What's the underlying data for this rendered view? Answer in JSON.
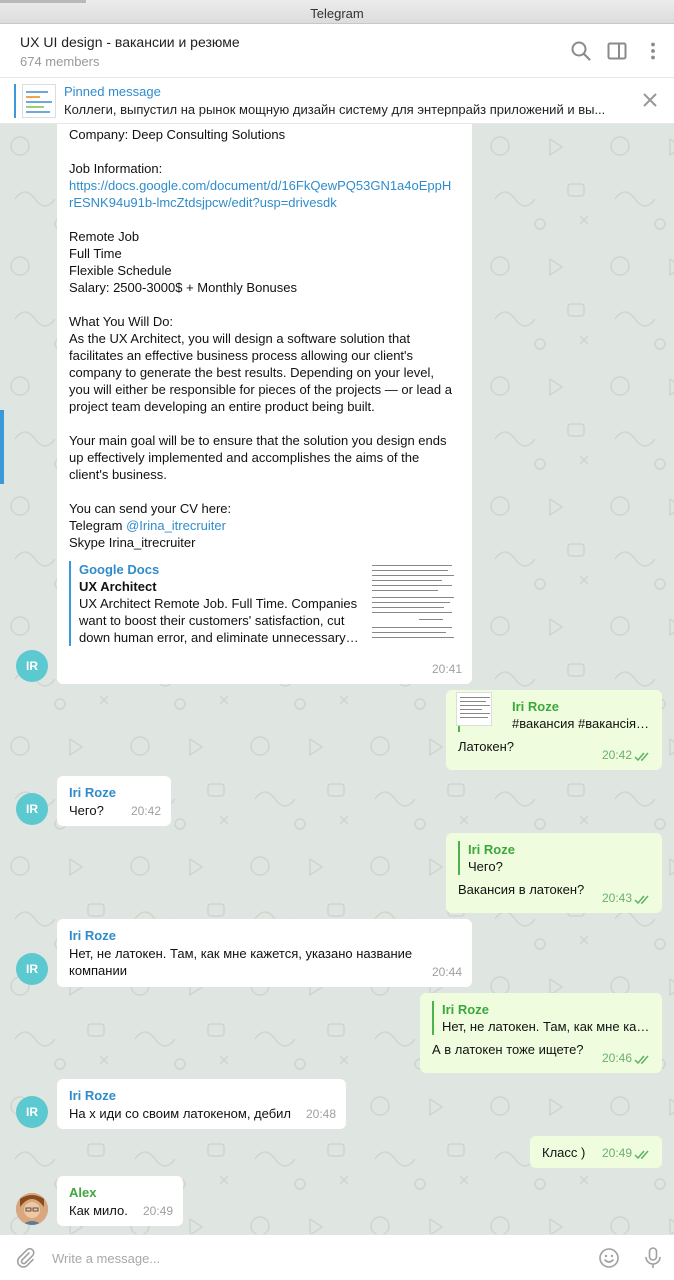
{
  "window": {
    "title": "Telegram"
  },
  "header": {
    "title": "UX UI design - вакансии и резюме",
    "members": "674 members"
  },
  "icons": {
    "search": "search-icon",
    "sidebar": "sidebar-toggle-icon",
    "more": "more-vertical-icon",
    "close": "close-icon",
    "attach": "paperclip-icon",
    "emoji": "emoji-icon",
    "mic": "microphone-icon",
    "check": "double-check-icon"
  },
  "pinned": {
    "label": "Pinned message",
    "text": "Коллеги, выпустил на рынок мощную дизайн систему для энтерпрайз приложений и вы..."
  },
  "colors": {
    "accent": "#2f8ccc",
    "outgoing_bubble": "#effdde",
    "chat_background": "#dfe5e0",
    "avatar_ir": "#5cc9d0",
    "sender_green": "#3da73d"
  },
  "messages": {
    "m1": {
      "company": "Company: Deep Consulting Solutions",
      "job_info_label": "Job Information:",
      "link_line1": "https://docs.google.com/document/d/16FkQewPQ53GN1a4oEppH",
      "link_line2": "rESNK94u91b-lmcZtdsjpcw/edit?usp=drivesdk",
      "remote": "Remote Job",
      "fulltime": "Full Time",
      "flexible": "Flexible Schedule",
      "salary": "Salary: 2500-3000$ + Monthly Bonuses",
      "what_title": "What You Will Do:",
      "what_l1": "As the UX Architect, you will design a software solution that",
      "what_l2": "facilitates an effective business process allowing our client's",
      "what_l3": "company to generate the best results. Depending on your level,",
      "what_l4": "you will either be responsible for pieces of the projects — or lead a",
      "what_l5": "project team developing an entire product being built.",
      "goal_l1": "Your main goal will be to ensure that the solution you design ends",
      "goal_l2": "up effectively implemented and accomplishes the aims of the",
      "goal_l3": "client's business.",
      "cv_title": "You can send your CV here:",
      "telegram_prefix": "Telegram ",
      "telegram_handle": "@Irina_itrecruiter",
      "skype": "Skype Irina_itrecruiter",
      "preview_site": "Google Docs",
      "preview_title": "UX Architect",
      "preview_l1": "UX Architect Remote Job. Full Time.  Companies",
      "preview_l2": "want to boost their customers' satisfaction, cut",
      "preview_l3": "down human error, and eliminate unnecessary…",
      "time": "20:41",
      "avatar": "IR"
    },
    "m2": {
      "reply_name": "Iri Roze",
      "reply_text": "#вакансия #вакансія…",
      "text": "Латокен?",
      "time": "20:42"
    },
    "m3": {
      "sender": "Iri Roze",
      "text": "Чего?",
      "time": "20:42",
      "avatar": "IR"
    },
    "m4": {
      "reply_name": "Iri Roze",
      "reply_text": "Чего?",
      "text": "Вакансия в латокен?",
      "time": "20:43"
    },
    "m5": {
      "sender": "Iri Roze",
      "text_l1": "Нет, не латокен. Там, как мне кажется, указано название",
      "text_l2": "компании",
      "time": "20:44",
      "avatar": "IR"
    },
    "m6": {
      "reply_name": "Iri Roze",
      "reply_text": "Нет, не латокен. Там, как мне ка…",
      "text": "А в латокен тоже ищете?",
      "time": "20:46"
    },
    "m7": {
      "sender": "Iri Roze",
      "text": "На х иди со своим латокеном, дебил",
      "time": "20:48",
      "avatar": "IR"
    },
    "m8": {
      "text": "Класс )",
      "time": "20:49"
    },
    "m9": {
      "sender": "Alex",
      "text": "Как мило.",
      "time": "20:49"
    }
  },
  "composer": {
    "placeholder": "Write a message..."
  }
}
